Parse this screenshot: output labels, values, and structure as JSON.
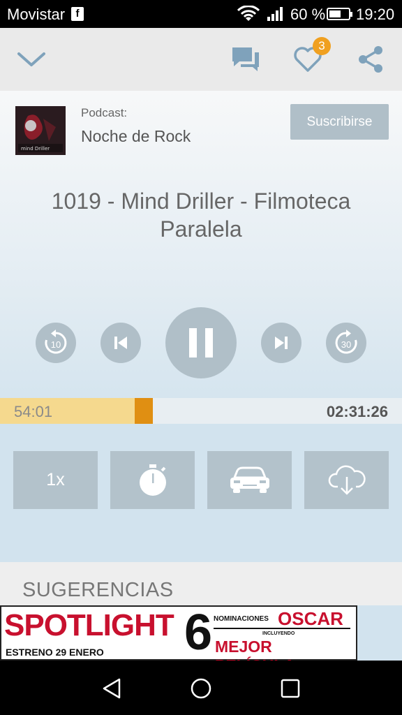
{
  "status_bar": {
    "carrier": "Movistar",
    "carrier_icon": "f",
    "battery_percent": "60 %",
    "battery_level": 0.6,
    "time": "19:20"
  },
  "toolbar": {
    "icons": [
      "chevron-down-icon",
      "chat-icon",
      "heart-icon",
      "share-icon"
    ],
    "favorites_badge": "3"
  },
  "podcast": {
    "label": "Podcast:",
    "name": "Noche de Rock",
    "subscribe_label": "Suscribirse",
    "artwork_text": "mind Driller"
  },
  "episode": {
    "title": "1019 - Mind Driller - Filmoteca Paralela"
  },
  "controls": {
    "rewind_seconds": "10",
    "forward_seconds": "30",
    "state": "playing"
  },
  "progress": {
    "elapsed": "54:01",
    "total": "02:31:26",
    "fraction": 0.357
  },
  "options": {
    "speed_label": "1x",
    "icons": [
      "sleep-timer-icon",
      "car-mode-icon",
      "cloud-download-icon"
    ]
  },
  "suggestions": {
    "title": "SUGERENCIAS"
  },
  "ad": {
    "headline": "SPOTLIGHT",
    "release": "ESTRENO 29 ENERO",
    "number": "6",
    "nominations": "NOMINACIONES",
    "award": "OSCAR",
    "including": "INCLUYENDO",
    "best_picture": "MEJOR PELÍCULA"
  },
  "colors": {
    "accent_orange": "#e08f12",
    "progress_fill": "#f5d98e",
    "button_gray": "#b0bfc8",
    "badge": "#f0a020"
  }
}
